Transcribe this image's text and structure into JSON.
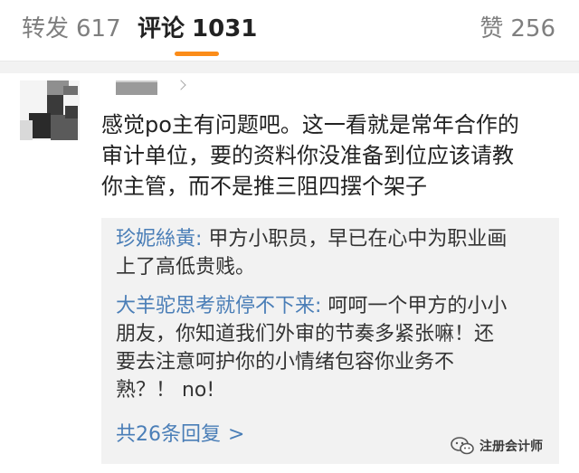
{
  "tabs": {
    "repost": {
      "label": "转发",
      "count": "617"
    },
    "comment": {
      "label": "评论",
      "count": "1031"
    },
    "like": {
      "label": "赞",
      "count": "256"
    }
  },
  "accent_color": "#fb8c19",
  "link_color": "#4a7eb7",
  "comment": {
    "avatar": "pixelated-avatar",
    "username": "",
    "text_lines": [
      "感觉po主有问题吧。这一看就是常年合作的",
      "审计单位，要的资料你没准备到位应该请教",
      "你主管，而不是推三阻四摆个架子"
    ],
    "replies": [
      {
        "author": "珍妮絲黃",
        "separator": ":",
        "lines": [
          " 甲方小职员，早已在心中为职业画",
          "上了高低贵贱。"
        ]
      },
      {
        "author": "大羊驼思考就停不下来",
        "separator": ":",
        "lines": [
          " 呵呵一个甲方的小小",
          "朋友，你知道我们外审的节奏多紧张嘛！还",
          "要去注意呵护你的小情绪包容你业务不",
          "熟？！ no!"
        ]
      }
    ],
    "more_replies": "共26条回复",
    "more_arrow": ">"
  },
  "watermark": {
    "icon": "wechat-icon",
    "text": "注册会计师"
  }
}
